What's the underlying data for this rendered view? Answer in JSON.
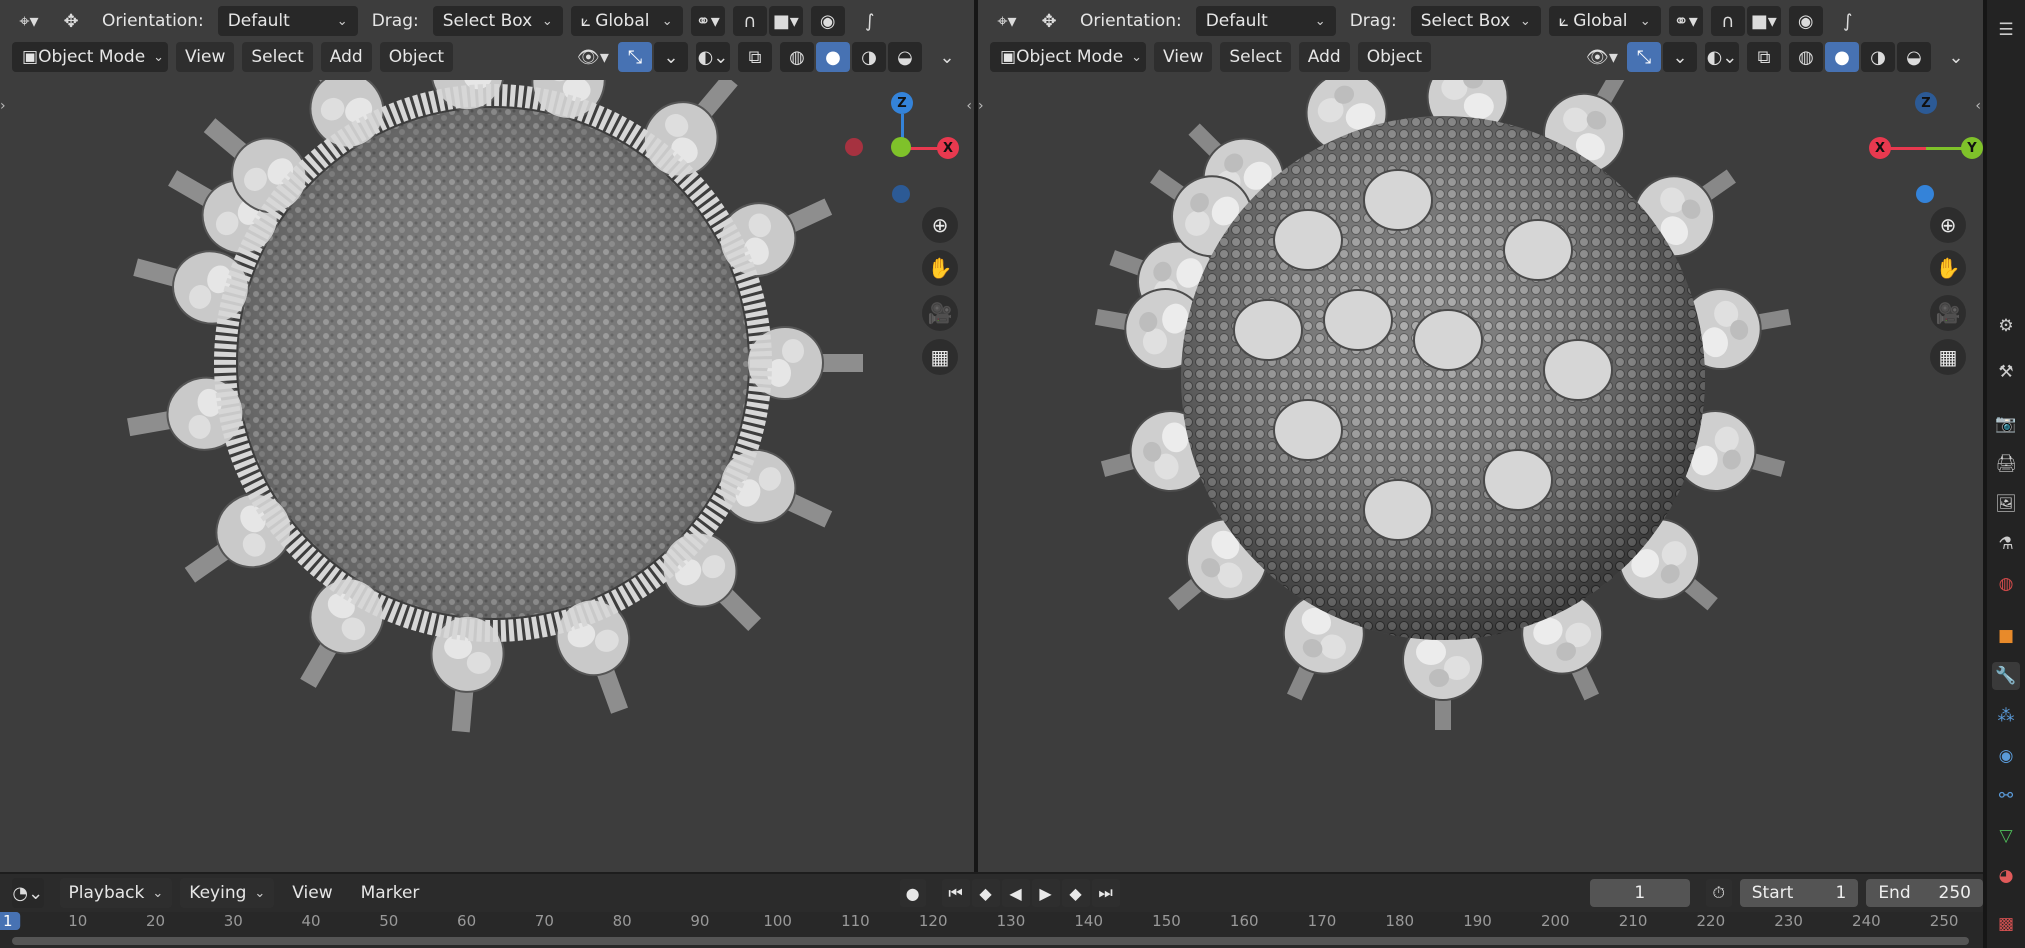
{
  "viewport_left": {
    "header": {
      "orientation_label": "Orientation:",
      "orientation_value": "Default",
      "drag_label": "Drag:",
      "drag_value": "Select Box",
      "transform_space": "Global",
      "mode": "Object Mode",
      "menus": [
        "View",
        "Select",
        "Add",
        "Object"
      ]
    },
    "gizmo": {
      "top_axis": "Z",
      "side_axis": "X"
    },
    "subject": "virus-model-cross-section"
  },
  "viewport_right": {
    "header": {
      "orientation_label": "Orientation:",
      "orientation_value": "Default",
      "drag_label": "Drag:",
      "drag_value": "Select Box",
      "transform_space": "Global",
      "mode": "Object Mode",
      "menus": [
        "View",
        "Select",
        "Add",
        "Object"
      ]
    },
    "gizmo": {
      "top_axis": "Z",
      "left_axis": "X",
      "right_axis": "Y"
    },
    "subject": "virus-model-exterior"
  },
  "timeline": {
    "menus": [
      "Playback",
      "Keying",
      "View",
      "Marker"
    ],
    "current_frame": "1",
    "start_label": "Start",
    "start_value": "1",
    "end_label": "End",
    "end_value": "250",
    "ruler_ticks": [
      "1",
      "10",
      "20",
      "30",
      "40",
      "50",
      "60",
      "70",
      "80",
      "90",
      "100",
      "110",
      "120",
      "130",
      "140",
      "150",
      "160",
      "170",
      "180",
      "190",
      "200",
      "210",
      "220",
      "230",
      "240",
      "250"
    ],
    "playhead_frame": 1,
    "frame_range": [
      0,
      255
    ]
  },
  "colors": {
    "accent": "#4772b3",
    "axis_x": "#e8394f",
    "axis_y": "#7fc22a",
    "axis_z": "#3483d9",
    "viewport_bg": "#3d3d3d"
  },
  "properties_icons": [
    "tool-icon",
    "render-icon",
    "output-icon",
    "view-layer-icon",
    "scene-icon",
    "world-icon",
    "object-icon",
    "modifier-icon",
    "particles-icon",
    "physics-icon",
    "constraints-icon",
    "data-icon",
    "material-icon",
    "texture-icon"
  ]
}
